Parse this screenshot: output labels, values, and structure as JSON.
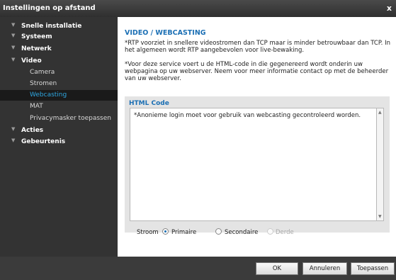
{
  "window": {
    "title": "Instellingen op afstand",
    "close_glyph": "x"
  },
  "sidebar": {
    "items": [
      {
        "label": "Snelle installatie",
        "level": 0
      },
      {
        "label": "Systeem",
        "level": 0
      },
      {
        "label": "Netwerk",
        "level": 0
      },
      {
        "label": "Video",
        "level": 0
      },
      {
        "label": "Camera",
        "level": 1
      },
      {
        "label": "Stromen",
        "level": 1
      },
      {
        "label": "Webcasting",
        "level": 1,
        "active": true
      },
      {
        "label": "MAT",
        "level": 1
      },
      {
        "label": "Privacymasker toepassen",
        "level": 1
      },
      {
        "label": "Acties",
        "level": 0
      },
      {
        "label": "Gebeurtenis",
        "level": 0
      }
    ]
  },
  "main": {
    "heading": "VIDEO / WEBCASTING",
    "para1": "*RTP voorziet in snellere videostromen dan TCP maar is minder betrouwbaar dan TCP. In het algemeen wordt RTP aangebevolen voor live-bewaking.",
    "para2": "*Voor deze service voert u de HTML-code in die gegenereerd wordt onderin uw webpagina op uw webserver. Neem voor meer informatie contact op met de beheerder van uw webserver.",
    "html_code": {
      "label": "HTML Code",
      "value": "*Anonieme login moet voor gebruik van webcasting gecontroleerd worden."
    },
    "stream": {
      "label": "Stroom",
      "options": [
        {
          "label": "Primaire",
          "checked": true,
          "disabled": false
        },
        {
          "label": "Secondaire",
          "checked": false,
          "disabled": false
        },
        {
          "label": "Derde",
          "checked": false,
          "disabled": true
        }
      ]
    }
  },
  "footer": {
    "ok": "OK",
    "cancel": "Annuleren",
    "apply": "Toepassen"
  },
  "colors": {
    "accent": "#2ea6e0",
    "heading": "#1b6fb4",
    "sidebar_bg": "#333333",
    "active_bg": "#1a1a1a"
  }
}
